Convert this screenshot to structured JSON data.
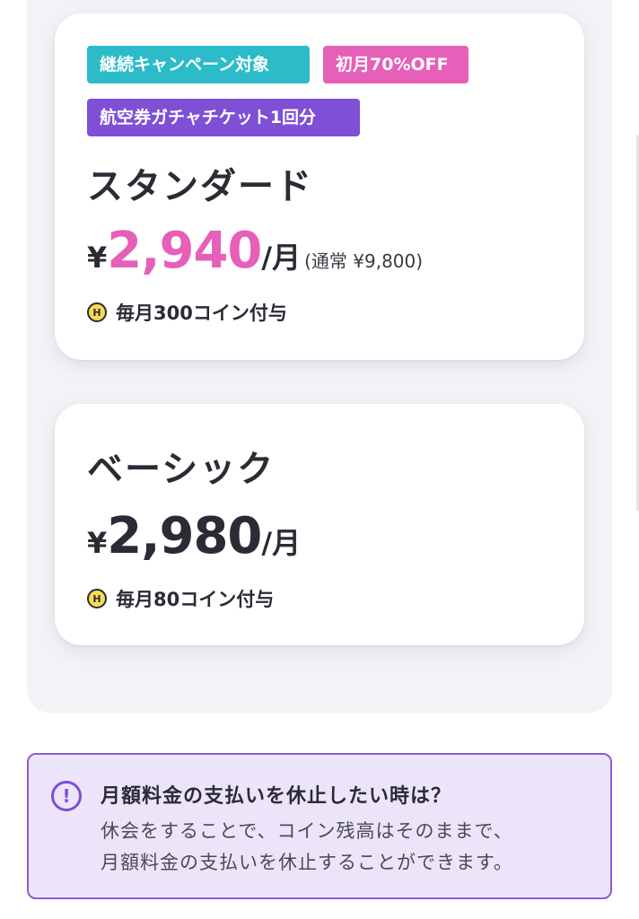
{
  "plans": [
    {
      "badges": [
        "継続キャンペーン対象",
        "初月70%OFF",
        "航空券ガチャチケット1回分"
      ],
      "name": "スタンダード",
      "yen": "¥",
      "price": "2,940",
      "per": "/月",
      "regular": "(通常 ¥9,800)",
      "coin_icon_label": "H",
      "coins": "毎月300コイン付与"
    },
    {
      "name": "ベーシック",
      "yen": "¥",
      "price": "2,980",
      "per": "/月",
      "coin_icon_label": "H",
      "coins": "毎月80コイン付与"
    }
  ],
  "notice": {
    "icon": "!",
    "title": "月額料金の支払いを休止したい時は？",
    "body": [
      "休会をすることで、コイン残高はそのままで、",
      "月額料金の支払いを休止することができます。"
    ]
  },
  "colors": {
    "accent_pink": "#e65fb8",
    "teal": "#2bbbc9",
    "purple": "#7f4fd6",
    "notice_bg": "#ece5fa"
  }
}
